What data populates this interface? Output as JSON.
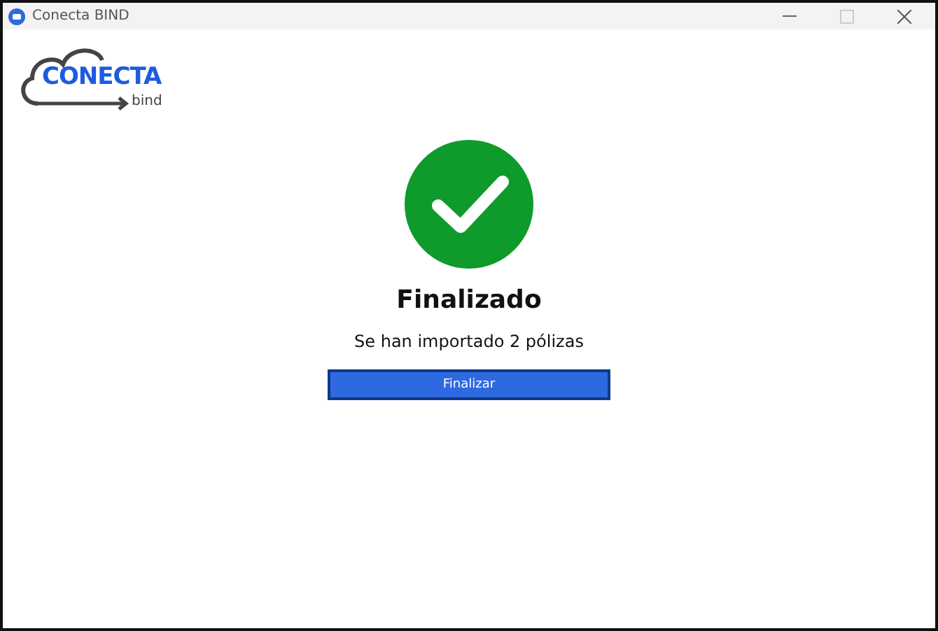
{
  "window": {
    "title": "Conecta BIND"
  },
  "logo": {
    "name": "CONECTA",
    "sub": "bind"
  },
  "result": {
    "title": "Finalizado",
    "message": "Se han importado 2 pólizas"
  },
  "buttons": [
    {
      "label": "Finalizar",
      "kind": "primary"
    }
  ]
}
